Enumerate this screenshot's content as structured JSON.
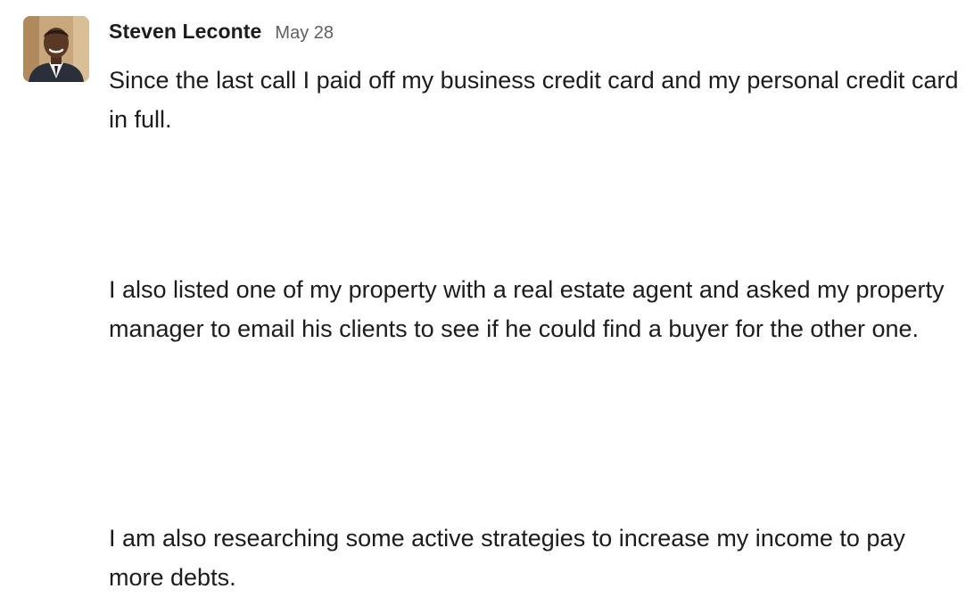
{
  "message": {
    "author": "Steven Leconte",
    "timestamp": "May 28",
    "paragraphs": [
      "Since the last call I paid off my business credit card and my personal credit card in full.",
      "I also listed one of my property with a real estate agent and asked my property manager to email his clients to see if he could find a buyer for the other one.",
      "I am also researching some active strategies to increase my income to pay more debts."
    ],
    "avatar": {
      "icon": "user-photo-avatar",
      "colors": {
        "background": "#c9a77c",
        "skin": "#5a3826",
        "suit": "#2b2f3a",
        "shirt": "#f2f2f2"
      }
    }
  }
}
